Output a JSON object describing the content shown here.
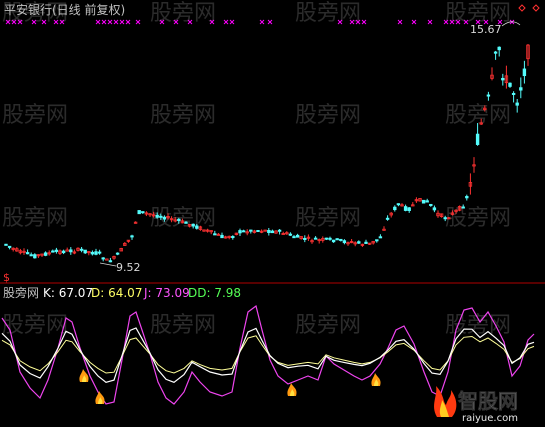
{
  "upper": {
    "title": "平安银行(日线 前复权)",
    "high_label": "15.67",
    "low_label": "9.52",
    "left_marker": "$",
    "colors": {
      "up": "#ff3232",
      "down": "#54fcfc",
      "title": "#c0c0c0",
      "marker": "#ff00ff"
    }
  },
  "indicator": {
    "name": "股旁网",
    "k_text": "K: 67.07",
    "d_text": "D: 64.07",
    "j_text": "J: 73.09",
    "dd_text": "DD: 7.98",
    "colors": {
      "k": "#ffffff",
      "d": "#ffff66",
      "j": "#ff55ff",
      "dd": "#55ff55"
    }
  },
  "watermarks": [
    "股旁网"
  ],
  "logo": {
    "text": "智股网",
    "url_text": "raiyue.com"
  }
}
